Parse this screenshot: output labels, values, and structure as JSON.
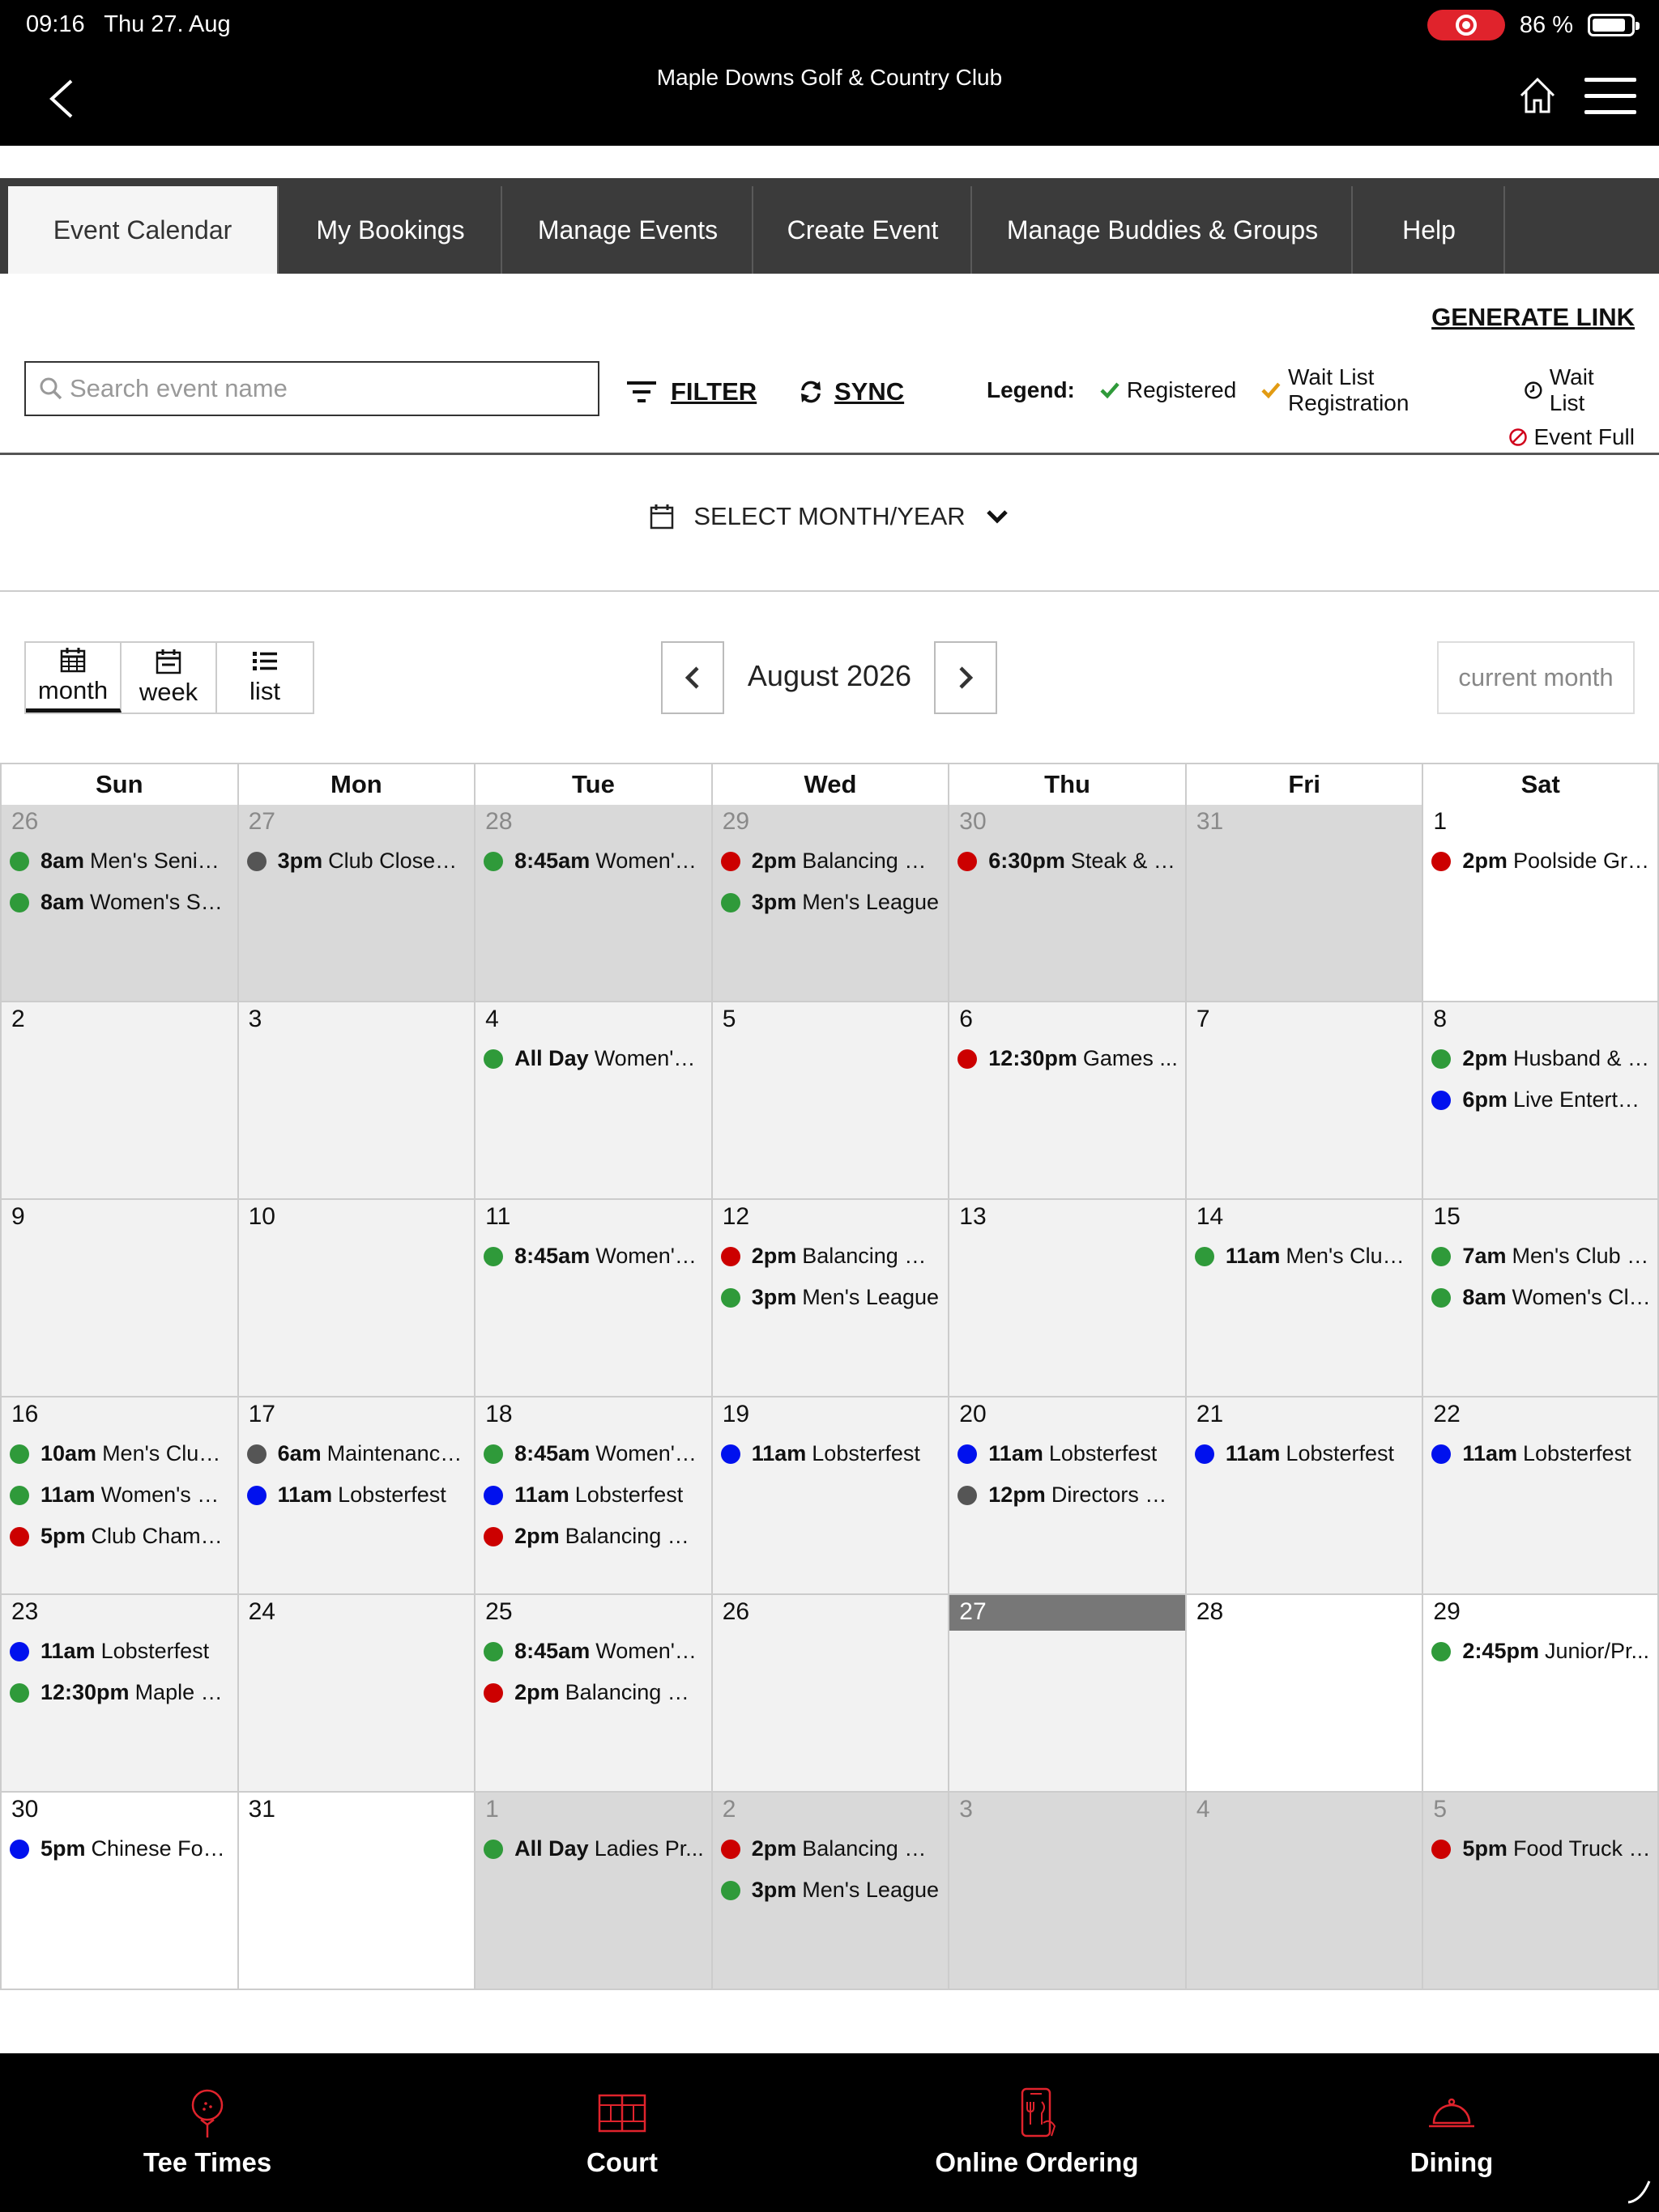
{
  "status": {
    "time": "09:16",
    "date": "Thu 27. Aug",
    "battery": "86 %"
  },
  "header": {
    "title": "Maple Downs Golf & Country Club"
  },
  "tabs": [
    {
      "label": "Event Calendar"
    },
    {
      "label": "My Bookings"
    },
    {
      "label": "Manage Events"
    },
    {
      "label": "Create Event"
    },
    {
      "label": "Manage Buddies & Groups"
    },
    {
      "label": "Help"
    }
  ],
  "toolbar": {
    "generate_link": "GENERATE LINK",
    "search_placeholder": "Search event name",
    "filter": "FILTER",
    "sync": "SYNC"
  },
  "legend": {
    "title": "Legend:",
    "registered": "Registered",
    "waitlist_registration": "Wait List Registration",
    "waitlist": "Wait List",
    "event_full": "Event Full"
  },
  "month_select": {
    "label": "SELECT MONTH/YEAR"
  },
  "views": [
    {
      "label": "month"
    },
    {
      "label": "week"
    },
    {
      "label": "list"
    }
  ],
  "calendar": {
    "month_label": "August 2026",
    "current_month": "current month",
    "weekdays": [
      "Sun",
      "Mon",
      "Tue",
      "Wed",
      "Thu",
      "Fri",
      "Sat"
    ],
    "colors": {
      "green": "#2f9a3a",
      "red": "#cc0000",
      "blue": "#0011ee",
      "gray": "#555555"
    },
    "days": [
      {
        "day": "26",
        "kind": "other",
        "events": [
          {
            "c": "green",
            "t": "8am",
            "n": "Men's Senior ..."
          },
          {
            "c": "green",
            "t": "8am",
            "n": "Women's Sen..."
          }
        ]
      },
      {
        "day": "27",
        "kind": "other",
        "events": [
          {
            "c": "gray",
            "t": "3pm",
            "n": "Club Closed -..."
          }
        ]
      },
      {
        "day": "28",
        "kind": "other",
        "events": [
          {
            "c": "green",
            "t": "8:45am",
            "n": "Women's ..."
          }
        ]
      },
      {
        "day": "29",
        "kind": "other",
        "events": [
          {
            "c": "red",
            "t": "2pm",
            "n": "Balancing Cl..."
          },
          {
            "c": "green",
            "t": "3pm",
            "n": "Men's League"
          }
        ]
      },
      {
        "day": "30",
        "kind": "other",
        "events": [
          {
            "c": "red",
            "t": "6:30pm",
            "n": "Steak & Ci..."
          }
        ]
      },
      {
        "day": "31",
        "kind": "other",
        "events": []
      },
      {
        "day": "1",
        "kind": "future",
        "events": [
          {
            "c": "red",
            "t": "2pm",
            "n": "Poolside Grill..."
          }
        ]
      },
      {
        "day": "2",
        "kind": "past",
        "events": []
      },
      {
        "day": "3",
        "kind": "past",
        "events": []
      },
      {
        "day": "4",
        "kind": "past",
        "events": [
          {
            "c": "green",
            "t": "All Day",
            "n": "Women's ..."
          }
        ]
      },
      {
        "day": "5",
        "kind": "past",
        "events": []
      },
      {
        "day": "6",
        "kind": "past",
        "events": [
          {
            "c": "red",
            "t": "12:30pm",
            "n": "Games ..."
          }
        ]
      },
      {
        "day": "7",
        "kind": "past",
        "events": []
      },
      {
        "day": "8",
        "kind": "past",
        "events": [
          {
            "c": "green",
            "t": "2pm",
            "n": "Husband & W..."
          },
          {
            "c": "blue",
            "t": "6pm",
            "n": "Live Entertain..."
          }
        ]
      },
      {
        "day": "9",
        "kind": "past",
        "events": []
      },
      {
        "day": "10",
        "kind": "past",
        "events": []
      },
      {
        "day": "11",
        "kind": "past",
        "events": [
          {
            "c": "green",
            "t": "8:45am",
            "n": "Women's ..."
          }
        ]
      },
      {
        "day": "12",
        "kind": "past",
        "events": [
          {
            "c": "red",
            "t": "2pm",
            "n": "Balancing Cl..."
          },
          {
            "c": "green",
            "t": "3pm",
            "n": "Men's League"
          }
        ]
      },
      {
        "day": "13",
        "kind": "past",
        "events": []
      },
      {
        "day": "14",
        "kind": "past",
        "events": [
          {
            "c": "green",
            "t": "11am",
            "n": "Men's Club ..."
          }
        ]
      },
      {
        "day": "15",
        "kind": "past",
        "events": [
          {
            "c": "green",
            "t": "7am",
            "n": "Men's Club C..."
          },
          {
            "c": "green",
            "t": "8am",
            "n": "Women's Clu..."
          }
        ]
      },
      {
        "day": "16",
        "kind": "past",
        "events": [
          {
            "c": "green",
            "t": "10am",
            "n": "Men's Club ..."
          },
          {
            "c": "green",
            "t": "11am",
            "n": "Women's Cl..."
          },
          {
            "c": "red",
            "t": "5pm",
            "n": "Club Champi..."
          }
        ]
      },
      {
        "day": "17",
        "kind": "past",
        "events": [
          {
            "c": "gray",
            "t": "6am",
            "n": "Maintenance ..."
          },
          {
            "c": "blue",
            "t": "11am",
            "n": "Lobsterfest"
          }
        ]
      },
      {
        "day": "18",
        "kind": "past",
        "events": [
          {
            "c": "green",
            "t": "8:45am",
            "n": "Women's ..."
          },
          {
            "c": "blue",
            "t": "11am",
            "n": "Lobsterfest"
          },
          {
            "c": "red",
            "t": "2pm",
            "n": "Balancing Cl..."
          }
        ]
      },
      {
        "day": "19",
        "kind": "past",
        "events": [
          {
            "c": "blue",
            "t": "11am",
            "n": "Lobsterfest"
          }
        ]
      },
      {
        "day": "20",
        "kind": "past",
        "events": [
          {
            "c": "blue",
            "t": "11am",
            "n": "Lobsterfest"
          },
          {
            "c": "gray",
            "t": "12pm",
            "n": "Directors Day"
          }
        ]
      },
      {
        "day": "21",
        "kind": "past",
        "events": [
          {
            "c": "blue",
            "t": "11am",
            "n": "Lobsterfest"
          }
        ]
      },
      {
        "day": "22",
        "kind": "past",
        "events": [
          {
            "c": "blue",
            "t": "11am",
            "n": "Lobsterfest"
          }
        ]
      },
      {
        "day": "23",
        "kind": "past",
        "events": [
          {
            "c": "blue",
            "t": "11am",
            "n": "Lobsterfest"
          },
          {
            "c": "green",
            "t": "12:30pm",
            "n": "Maple C..."
          }
        ]
      },
      {
        "day": "24",
        "kind": "past",
        "events": []
      },
      {
        "day": "25",
        "kind": "past",
        "events": [
          {
            "c": "green",
            "t": "8:45am",
            "n": "Women's ..."
          },
          {
            "c": "red",
            "t": "2pm",
            "n": "Balancing Cl..."
          }
        ]
      },
      {
        "day": "26",
        "kind": "past",
        "events": []
      },
      {
        "day": "27",
        "kind": "today",
        "events": []
      },
      {
        "day": "28",
        "kind": "future",
        "events": []
      },
      {
        "day": "29",
        "kind": "future",
        "events": [
          {
            "c": "green",
            "t": "2:45pm",
            "n": "Junior/Pr..."
          }
        ]
      },
      {
        "day": "30",
        "kind": "future",
        "events": [
          {
            "c": "blue",
            "t": "5pm",
            "n": "Chinese Food..."
          }
        ]
      },
      {
        "day": "31",
        "kind": "future",
        "events": []
      },
      {
        "day": "1",
        "kind": "other",
        "events": [
          {
            "c": "green",
            "t": "All Day",
            "n": "Ladies Pr..."
          }
        ]
      },
      {
        "day": "2",
        "kind": "other",
        "events": [
          {
            "c": "red",
            "t": "2pm",
            "n": "Balancing Cl..."
          },
          {
            "c": "green",
            "t": "3pm",
            "n": "Men's League"
          }
        ]
      },
      {
        "day": "3",
        "kind": "other",
        "events": []
      },
      {
        "day": "4",
        "kind": "other",
        "events": []
      },
      {
        "day": "5",
        "kind": "other",
        "events": [
          {
            "c": "red",
            "t": "5pm",
            "n": "Food Truck Bl..."
          }
        ]
      }
    ]
  },
  "bottom_nav": [
    {
      "label": "Tee Times",
      "icon": "golf-ball-tee-icon"
    },
    {
      "label": "Court",
      "icon": "court-icon"
    },
    {
      "label": "Online Ordering",
      "icon": "phone-cutlery-icon"
    },
    {
      "label": "Dining",
      "icon": "cloche-icon"
    }
  ],
  "accent_color": "#e0232c"
}
